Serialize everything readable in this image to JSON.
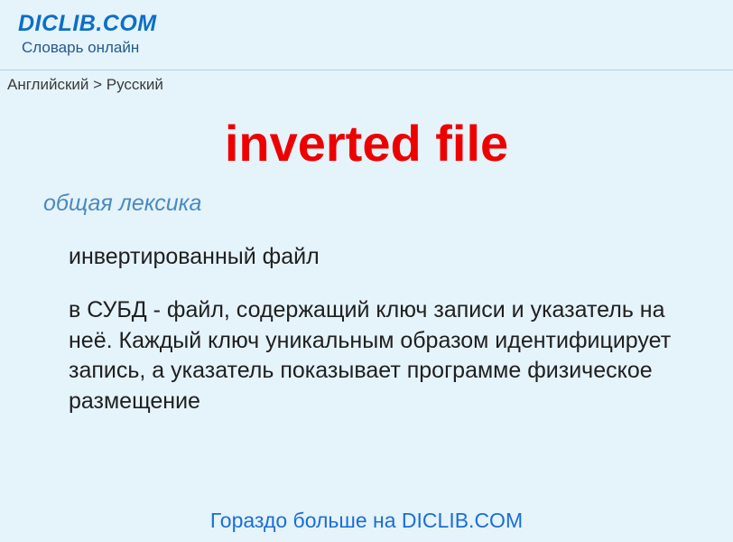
{
  "header": {
    "logo": "DICLIB.COM",
    "tagline": "Словарь онлайн"
  },
  "breadcrumb": {
    "from": "Английский",
    "separator": " > ",
    "to": "Русский"
  },
  "entry": {
    "term": "inverted file",
    "category": "общая лексика",
    "definition": "инвертированный файл",
    "description": "в СУБД - файл, содержащий ключ записи и указатель на неё. Каждый ключ уникальным образом идентифицирует запись, а указатель показывает программе физическое размещение"
  },
  "footer": {
    "link_text": "Гораздо больше на DICLIB.COM"
  }
}
